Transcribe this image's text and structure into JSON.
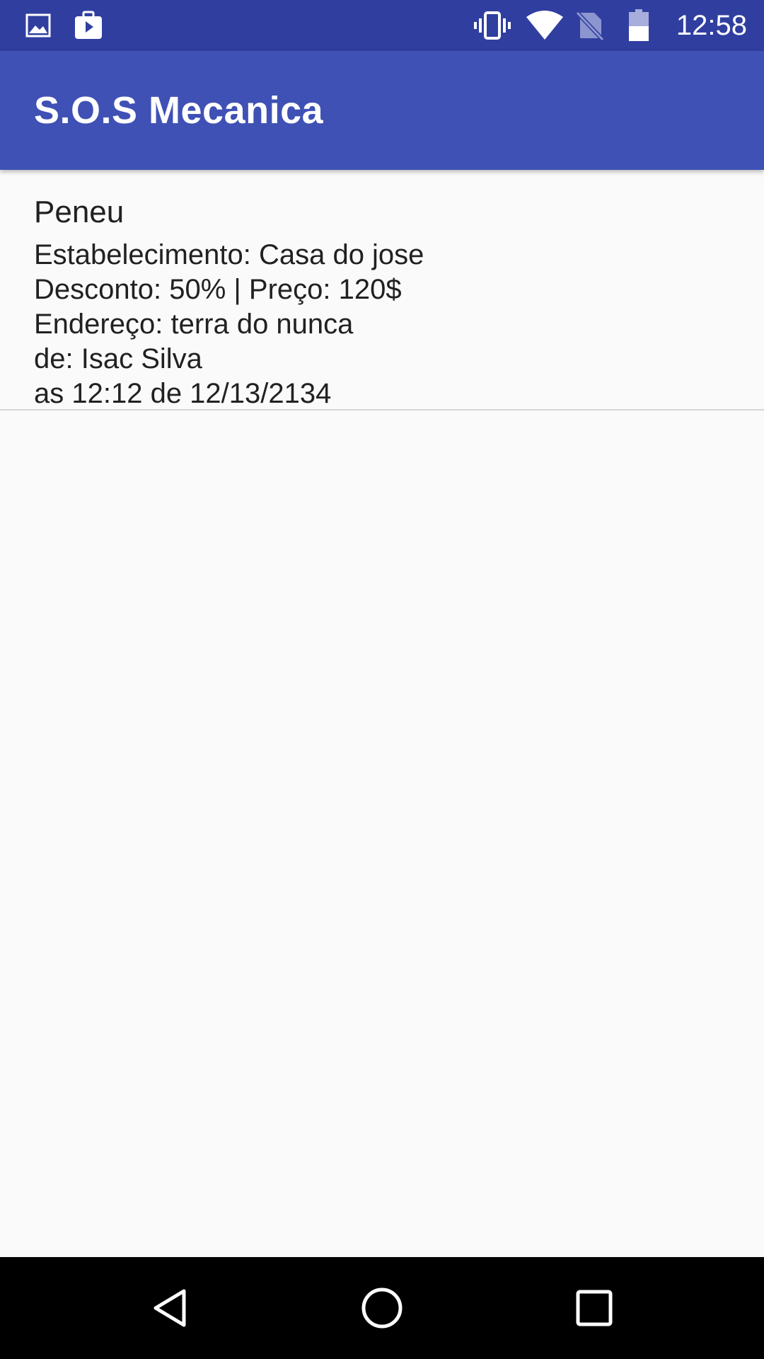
{
  "status_bar": {
    "time": "12:58",
    "left_icons": [
      "image-icon",
      "play-store-icon"
    ],
    "right_icons": [
      "vibrate-icon",
      "wifi-icon",
      "no-sim-icon",
      "battery-icon"
    ],
    "background": "#303f9f"
  },
  "app_bar": {
    "title": "S.O.S Mecanica",
    "background": "#3f51b5"
  },
  "list": {
    "items": [
      {
        "title": "Peneu",
        "establishment": "Estabelecimento: Casa do jose",
        "discount_price": "Desconto: 50% | Preço: 120$",
        "address": "Endereço: terra do nunca",
        "author": "de: Isac Silva",
        "datetime": "as 12:12 de 12/13/2134"
      }
    ]
  },
  "nav_bar": {
    "buttons": [
      "back-icon",
      "home-icon",
      "recents-icon"
    ],
    "background": "#000000"
  }
}
